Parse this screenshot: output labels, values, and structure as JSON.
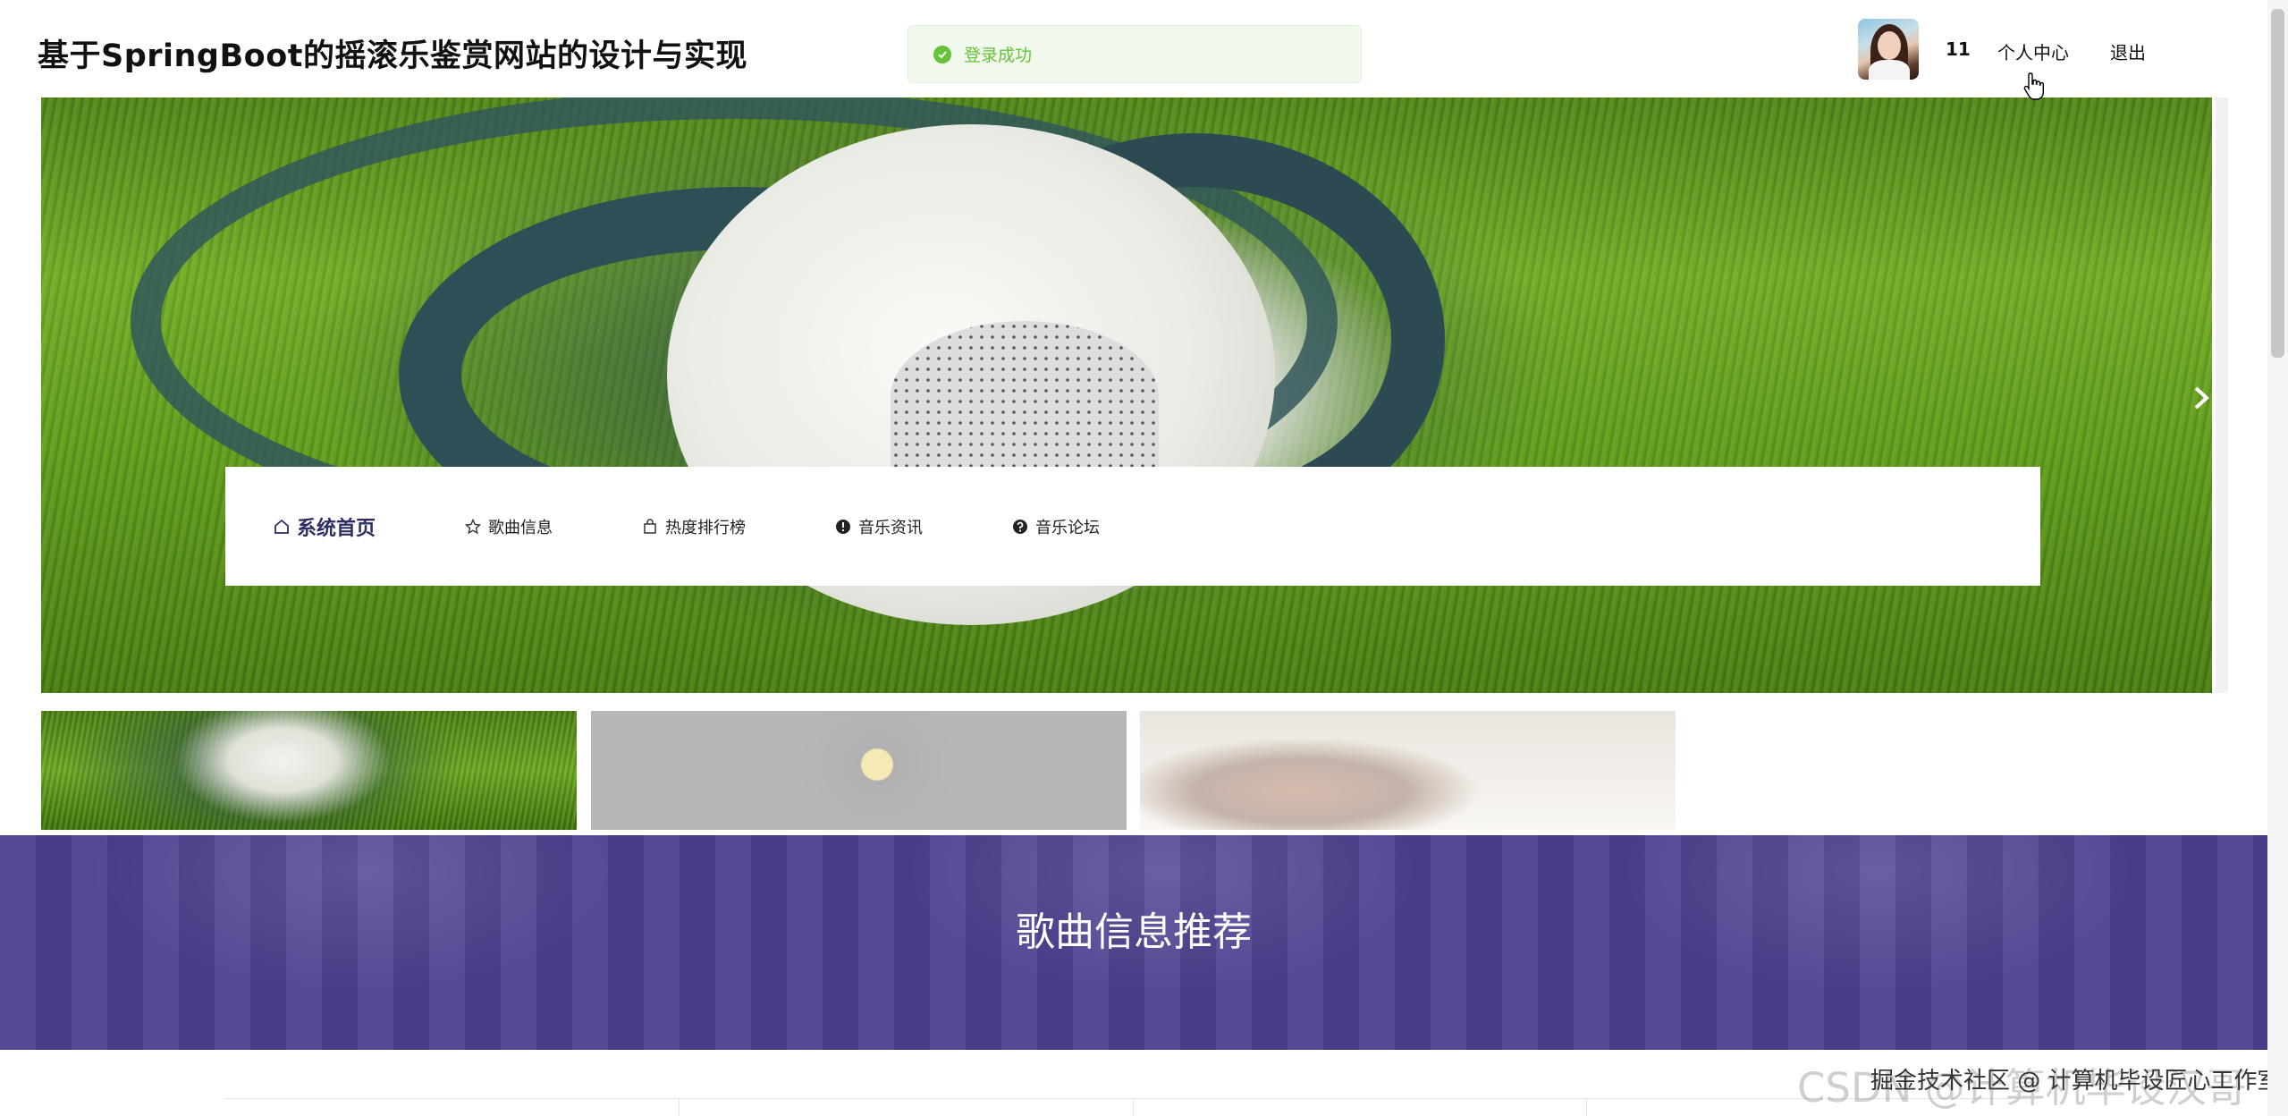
{
  "header": {
    "site_title": "基于SpringBoot的摇滚乐鉴赏网站的设计与实现",
    "toast": {
      "text": "登录成功",
      "icon": "check-circle-icon",
      "color": "#67c23a"
    },
    "user": {
      "name": "11",
      "center_label": "个人中心",
      "logout_label": "退出"
    }
  },
  "nav": {
    "items": [
      {
        "label": "系统首页",
        "icon": "home-icon",
        "active": true
      },
      {
        "label": "歌曲信息",
        "icon": "star-icon"
      },
      {
        "label": "热度排行榜",
        "icon": "bag-icon"
      },
      {
        "label": "音乐资讯",
        "icon": "info-circle-icon"
      },
      {
        "label": "音乐论坛",
        "icon": "question-circle-icon"
      }
    ],
    "active_color": "#2c2d63"
  },
  "banner": {
    "slides": 3,
    "active_slide": 1
  },
  "recommend": {
    "title": "歌曲信息推荐",
    "color": "#4c3f8f"
  },
  "watermark": {
    "background_text": "CSDN @计算机毕设汉哥",
    "foreground_text": "掘金技术社区 @ 计算机毕设匠心工作室"
  }
}
